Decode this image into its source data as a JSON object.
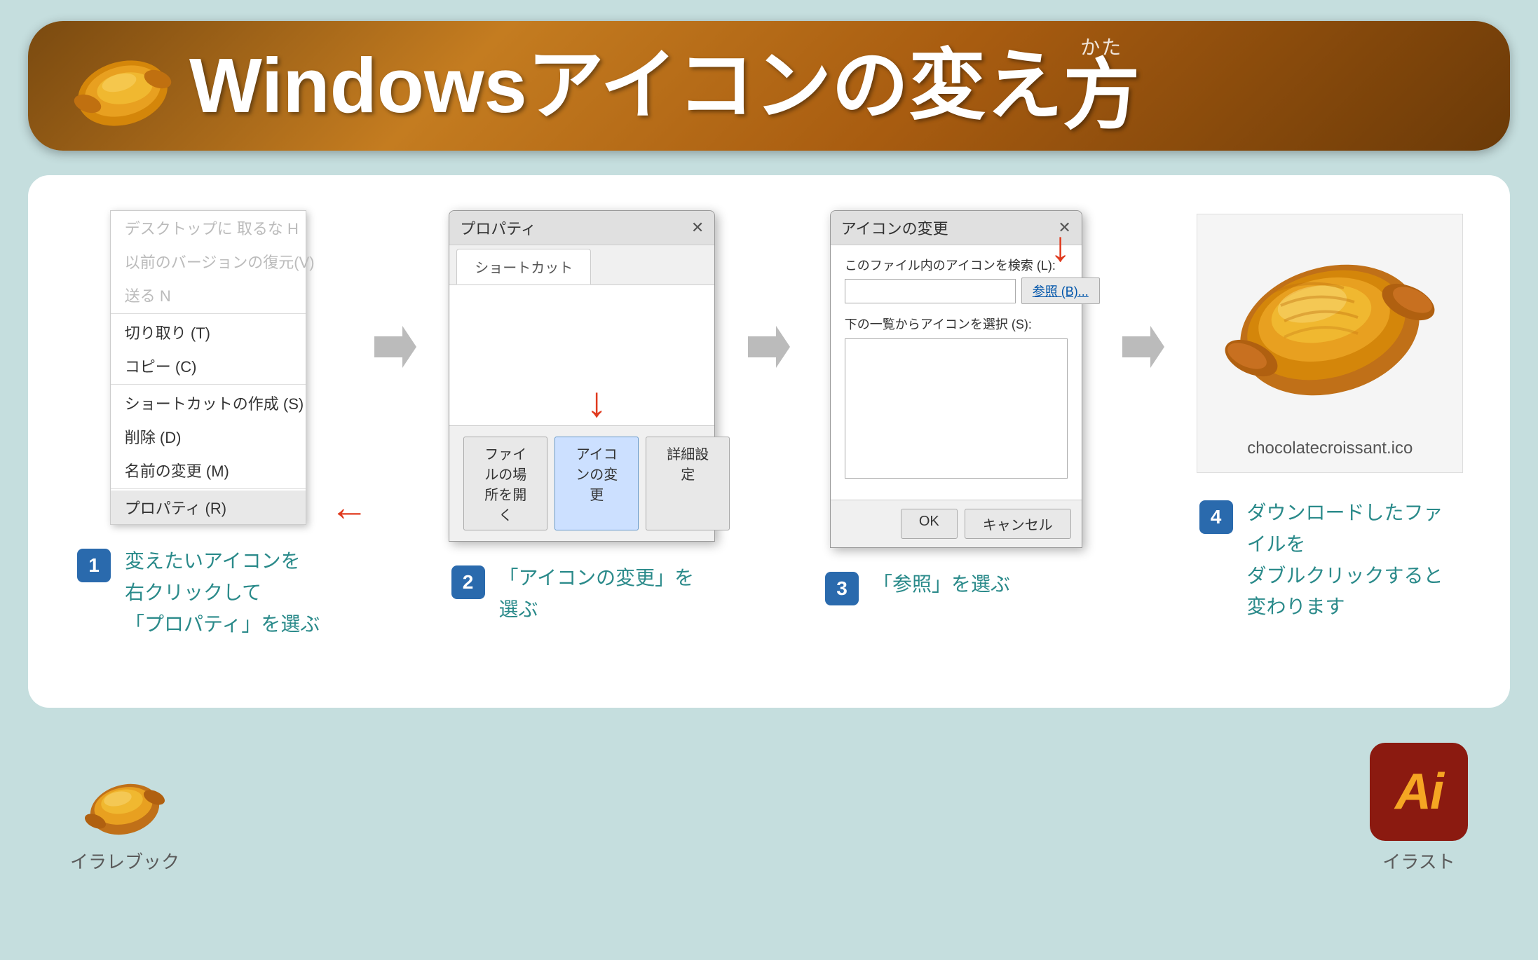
{
  "page": {
    "background_color": "#c5dede",
    "title": "Windows アイコンの変え方"
  },
  "header": {
    "title_part1": "Windows ",
    "title_part2": "アイコンの変え",
    "title_part3": "方",
    "furigana_ka": "か",
    "furigana_kata": "かた",
    "croissant_alt": "croissant icon"
  },
  "steps": [
    {
      "number": "1",
      "description": "変えたいアイコンを\n右クリックして\n「プロパティ」を選ぶ",
      "context_menu": {
        "items": [
          {
            "text": "デスクトップに 取るな H",
            "disabled": true
          },
          {
            "text": "以前のバージョンの復元(V)",
            "disabled": true
          },
          {
            "text": "送る N",
            "disabled": true
          },
          {
            "text": "切り取り (T)",
            "disabled": false
          },
          {
            "text": "コピー (C)",
            "disabled": false
          },
          {
            "text": "ショートカットの作成 (S)",
            "disabled": false
          },
          {
            "text": "削除 (D)",
            "disabled": false
          },
          {
            "text": "名前の変更 (M)",
            "disabled": false
          },
          {
            "text": "プロパティ (R)",
            "highlighted": true
          }
        ]
      }
    },
    {
      "number": "2",
      "description": "「アイコンの変更」を選ぶ",
      "dialog": {
        "title": "プロパティ",
        "tab": "ショートカット",
        "buttons": [
          {
            "label": "ファイルの場所を開く",
            "highlighted": false
          },
          {
            "label": "アイコンの変更",
            "highlighted": true
          },
          {
            "label": "詳細設定",
            "highlighted": false
          }
        ]
      }
    },
    {
      "number": "3",
      "description": "「参照」を選ぶ",
      "icon_dialog": {
        "title": "アイコンの変更",
        "search_label": "このファイル内のアイコンを検索 (L):",
        "browse_btn": "参照 (B)...",
        "list_label": "下の一覧からアイコンを選択 (S):",
        "ok_btn": "OK",
        "cancel_btn": "キャンセル"
      }
    },
    {
      "number": "4",
      "description": "ダウンロードしたファイルを\nダブルクリックすると変わります",
      "file_name": "chocolatecroissant.ico"
    }
  ],
  "footer": {
    "brand_name": "イラレブック",
    "illustrator_label": "イラスト",
    "ai_logo_text": "Ai"
  }
}
